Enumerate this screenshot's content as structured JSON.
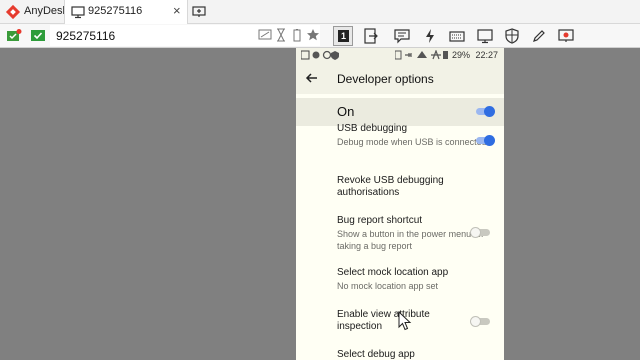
{
  "app": {
    "name": "AnyDesk"
  },
  "tab": {
    "label": "925275116",
    "close": "×"
  },
  "toolbar": {
    "address": "925275116",
    "session_number": "1"
  },
  "status_bar": {
    "battery": "29%",
    "time": "22:27"
  },
  "screen": {
    "title": "Developer options",
    "master_switch": {
      "label": "On",
      "on": true
    },
    "items": [
      {
        "title": "USB debugging",
        "subtitle": "Debug mode when USB is connected",
        "toggle": true,
        "on": true
      },
      {
        "title": "Revoke USB debugging authorisations",
        "subtitle": ""
      },
      {
        "title": "Bug report shortcut",
        "subtitle": "Show a button in the power menu for taking a bug report",
        "toggle": true,
        "on": false
      },
      {
        "title": "Select mock location app",
        "subtitle": "No mock location app set"
      },
      {
        "title": "Enable view attribute inspection",
        "subtitle": "",
        "toggle": true,
        "on": false
      },
      {
        "title": "Select debug app",
        "subtitle": ""
      }
    ]
  },
  "colors": {
    "accent_red": "#e63b2e",
    "toggle_on": "#2f6de1",
    "background": "#808080"
  },
  "icons": [
    "anydesk-logo",
    "monitor-icon",
    "new-tab-icon",
    "connection-status-icon",
    "verified-icon",
    "back-arrow-icon"
  ]
}
